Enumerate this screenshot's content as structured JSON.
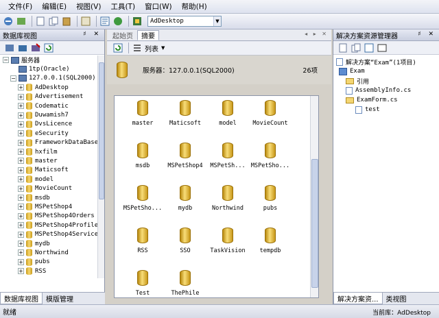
{
  "menu": [
    "文件(F)",
    "编辑(E)",
    "视图(V)",
    "工具(T)",
    "窗口(W)",
    "帮助(H)"
  ],
  "toolbar": {
    "combo_value": "AdDesktop"
  },
  "left_panel": {
    "title": "数据库视图",
    "ctrls": "♯ ✕",
    "tree": [
      {
        "label": "服务器",
        "level": 0,
        "kind": "root",
        "exp": "−"
      },
      {
        "label": "1tp(Oracle)",
        "level": 1,
        "kind": "server",
        "exp": ""
      },
      {
        "label": "127.0.0.1(SQL2000)",
        "level": 1,
        "kind": "server",
        "exp": "−"
      },
      {
        "label": "AdDesktop",
        "level": 2,
        "kind": "db",
        "exp": "+"
      },
      {
        "label": "Advertisement",
        "level": 2,
        "kind": "db",
        "exp": "+"
      },
      {
        "label": "Codematic",
        "level": 2,
        "kind": "db",
        "exp": "+"
      },
      {
        "label": "Duwamish7",
        "level": 2,
        "kind": "db",
        "exp": "+"
      },
      {
        "label": "DvsLicence",
        "level": 2,
        "kind": "db",
        "exp": "+"
      },
      {
        "label": "eSecurity",
        "level": 2,
        "kind": "db",
        "exp": "+"
      },
      {
        "label": "FrameworkDataBase",
        "level": 2,
        "kind": "db",
        "exp": "+"
      },
      {
        "label": "hxfilm",
        "level": 2,
        "kind": "db",
        "exp": "+"
      },
      {
        "label": "master",
        "level": 2,
        "kind": "db",
        "exp": "+"
      },
      {
        "label": "Maticsoft",
        "level": 2,
        "kind": "db",
        "exp": "+"
      },
      {
        "label": "model",
        "level": 2,
        "kind": "db",
        "exp": "+"
      },
      {
        "label": "MovieCount",
        "level": 2,
        "kind": "db",
        "exp": "+"
      },
      {
        "label": "msdb",
        "level": 2,
        "kind": "db",
        "exp": "+"
      },
      {
        "label": "MSPetShop4",
        "level": 2,
        "kind": "db",
        "exp": "+"
      },
      {
        "label": "MSPetShop4Orders",
        "level": 2,
        "kind": "db",
        "exp": "+"
      },
      {
        "label": "MSPetShop4Profile",
        "level": 2,
        "kind": "db",
        "exp": "+"
      },
      {
        "label": "MSPetShop4Services",
        "level": 2,
        "kind": "db",
        "exp": "+"
      },
      {
        "label": "mydb",
        "level": 2,
        "kind": "db",
        "exp": "+"
      },
      {
        "label": "Northwind",
        "level": 2,
        "kind": "db",
        "exp": "+"
      },
      {
        "label": "pubs",
        "level": 2,
        "kind": "db",
        "exp": "+"
      },
      {
        "label": "RSS",
        "level": 2,
        "kind": "db",
        "exp": "+"
      }
    ],
    "tabs": [
      "数据库视图",
      "模版管理"
    ]
  },
  "center": {
    "tabs": [
      "起始页",
      "摘要"
    ],
    "ctrls": "◂ ▸ ✕",
    "view_label": "列表",
    "server_label": "服务器：127.0.0.1(SQL2000)",
    "item_count": "26项",
    "items": [
      "master",
      "Maticsoft",
      "model",
      "MovieCount",
      "msdb",
      "MSPetShop4",
      "MSPetSh...",
      "MSPetSho...",
      "MSPetSho...",
      "mydb",
      "Northwind",
      "pubs",
      "RSS",
      "SSO",
      "TaskVision",
      "tempdb",
      "Test",
      "ThePhile"
    ]
  },
  "right_panel": {
    "title": "解决方案资源管理器",
    "ctrls": "♯ ✕",
    "tree": [
      {
        "label": "解决方案“Exam”(1项目)",
        "level": 0,
        "kind": "solution"
      },
      {
        "label": "Exam",
        "level": 0,
        "kind": "project"
      },
      {
        "label": "引用",
        "level": 1,
        "kind": "folder"
      },
      {
        "label": "AssemblyInfo.cs",
        "level": 1,
        "kind": "cs"
      },
      {
        "label": "ExamForm.cs",
        "level": 1,
        "kind": "folder"
      },
      {
        "label": "test",
        "level": 2,
        "kind": "cs"
      }
    ],
    "tabs": [
      "解决方案资...",
      "类视图"
    ]
  },
  "status": {
    "left": "就绪",
    "right": "当前库：AdDesktop"
  },
  "colors": {
    "accent": "#3a6ea5",
    "db_gold": "#f0c840"
  }
}
